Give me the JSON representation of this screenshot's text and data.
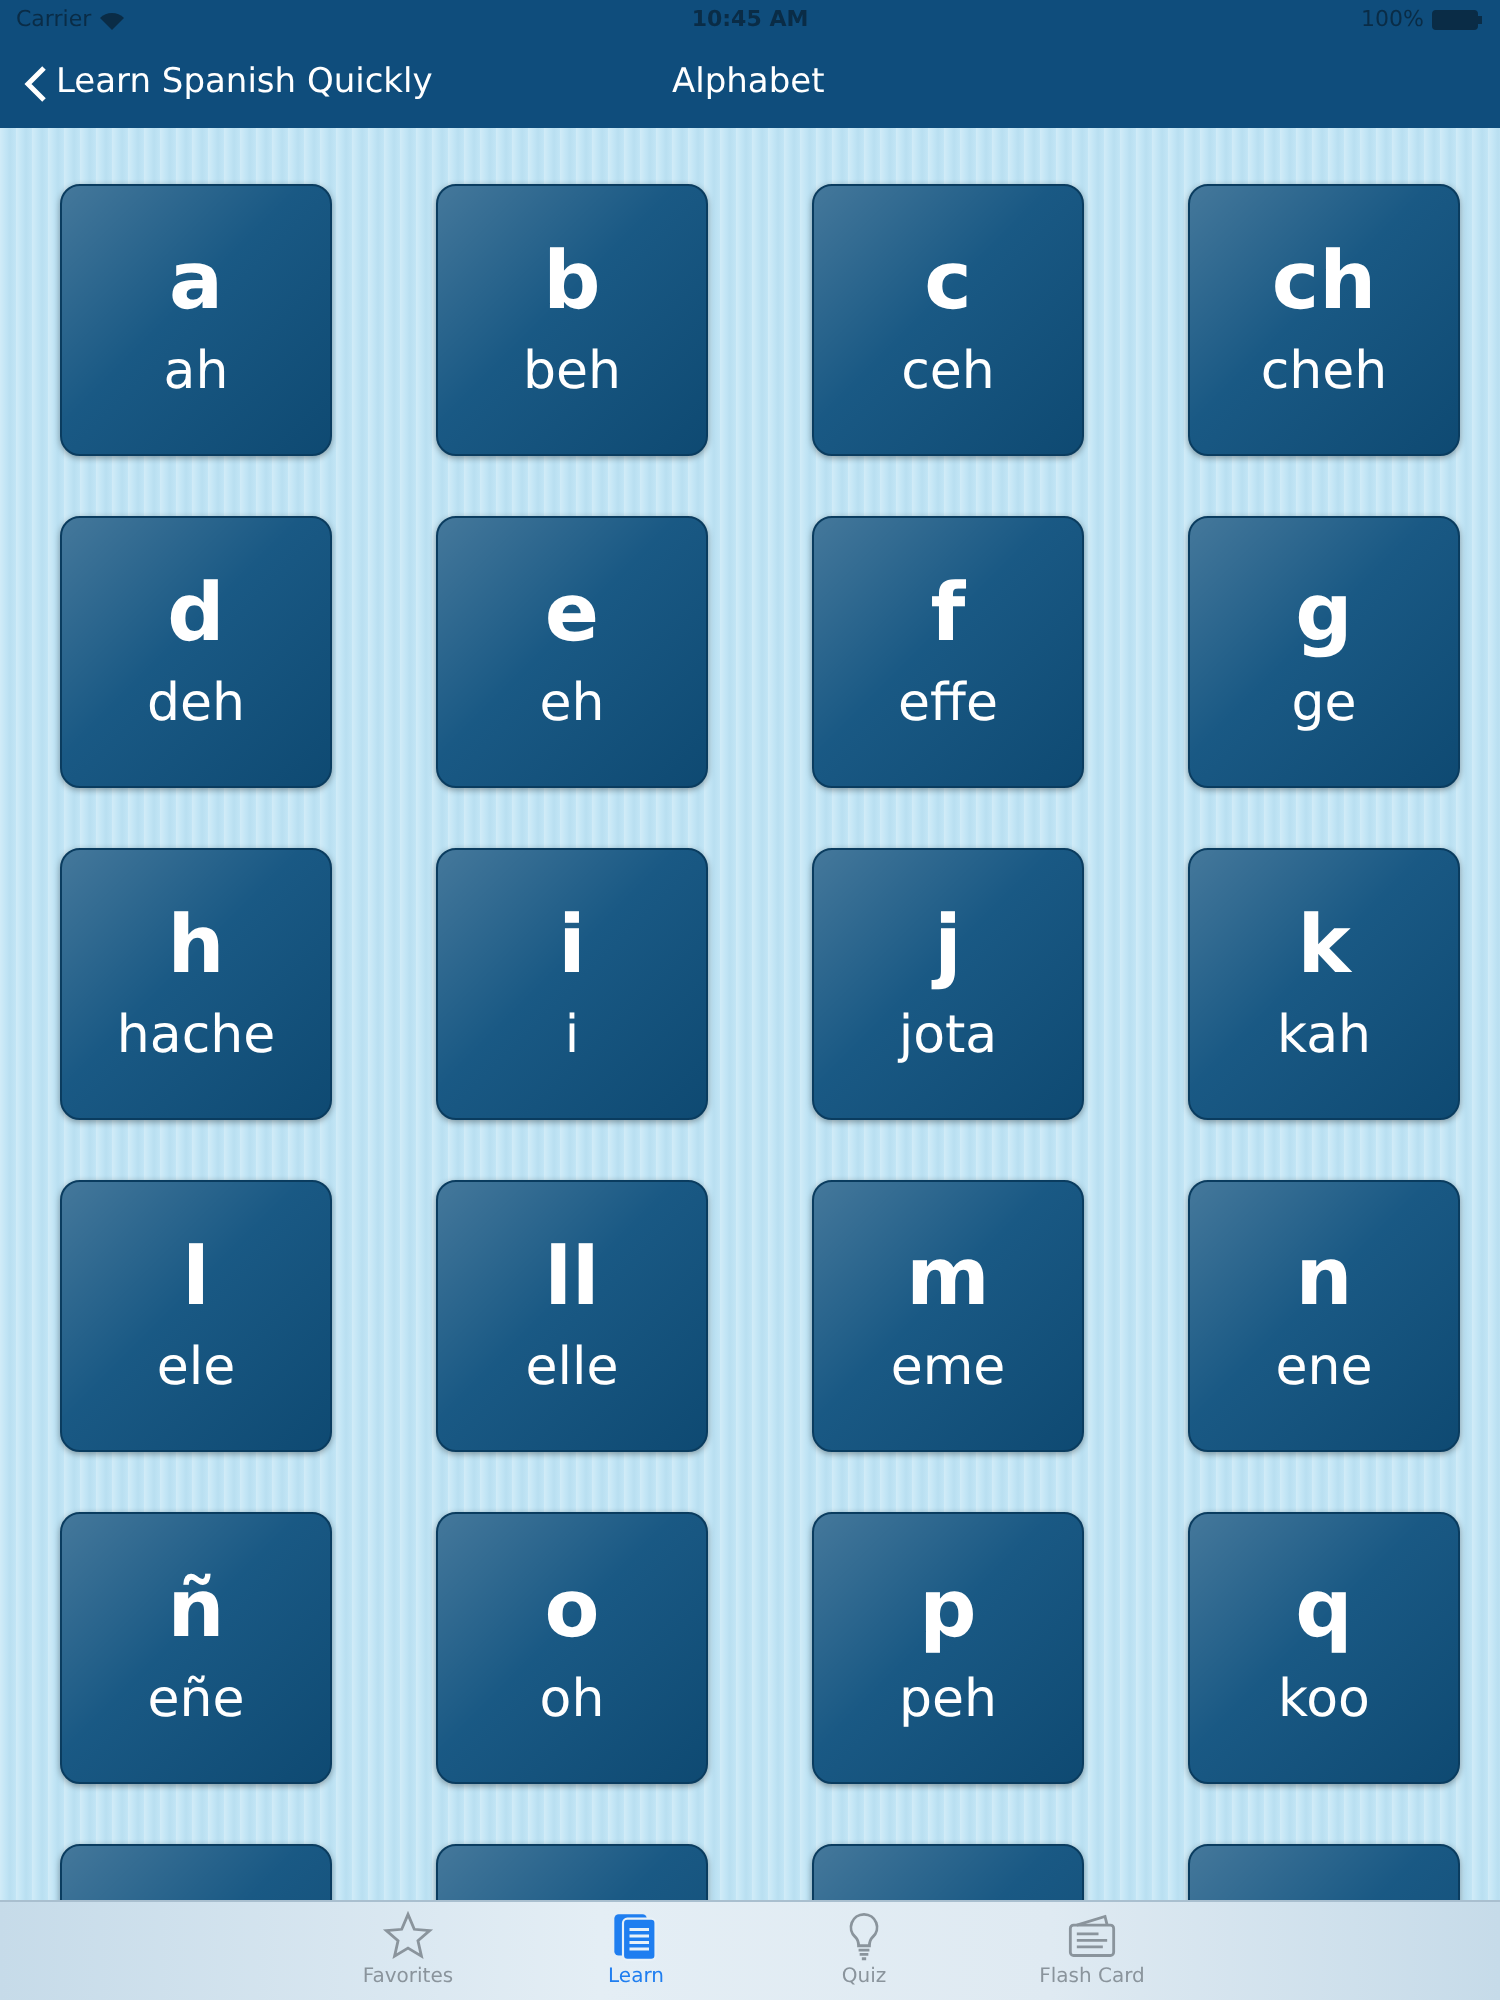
{
  "status_bar": {
    "carrier": "Carrier",
    "time": "10:45 AM",
    "battery": "100%"
  },
  "nav_bar": {
    "back": "Learn Spanish Quickly",
    "title": "Alphabet"
  },
  "letters": [
    {
      "letter": "a",
      "name": "ah"
    },
    {
      "letter": "b",
      "name": "beh"
    },
    {
      "letter": "c",
      "name": "ceh"
    },
    {
      "letter": "ch",
      "name": "cheh"
    },
    {
      "letter": "d",
      "name": "deh"
    },
    {
      "letter": "e",
      "name": "eh"
    },
    {
      "letter": "f",
      "name": "effe"
    },
    {
      "letter": "g",
      "name": "ge"
    },
    {
      "letter": "h",
      "name": "hache"
    },
    {
      "letter": "i",
      "name": "i"
    },
    {
      "letter": "j",
      "name": "jota"
    },
    {
      "letter": "k",
      "name": "kah"
    },
    {
      "letter": "l",
      "name": "ele"
    },
    {
      "letter": "ll",
      "name": "elle"
    },
    {
      "letter": "m",
      "name": "eme"
    },
    {
      "letter": "n",
      "name": "ene"
    },
    {
      "letter": "ñ",
      "name": "eñe"
    },
    {
      "letter": "o",
      "name": "oh"
    },
    {
      "letter": "p",
      "name": "peh"
    },
    {
      "letter": "q",
      "name": "koo"
    }
  ],
  "tab_bar": [
    {
      "kind": "star",
      "label": "Favorites",
      "selected": false
    },
    {
      "kind": "pages",
      "label": "Learn",
      "selected": true
    },
    {
      "kind": "bulb",
      "label": "Quiz",
      "selected": false
    },
    {
      "kind": "card",
      "label": "Flash Card",
      "selected": false
    }
  ]
}
